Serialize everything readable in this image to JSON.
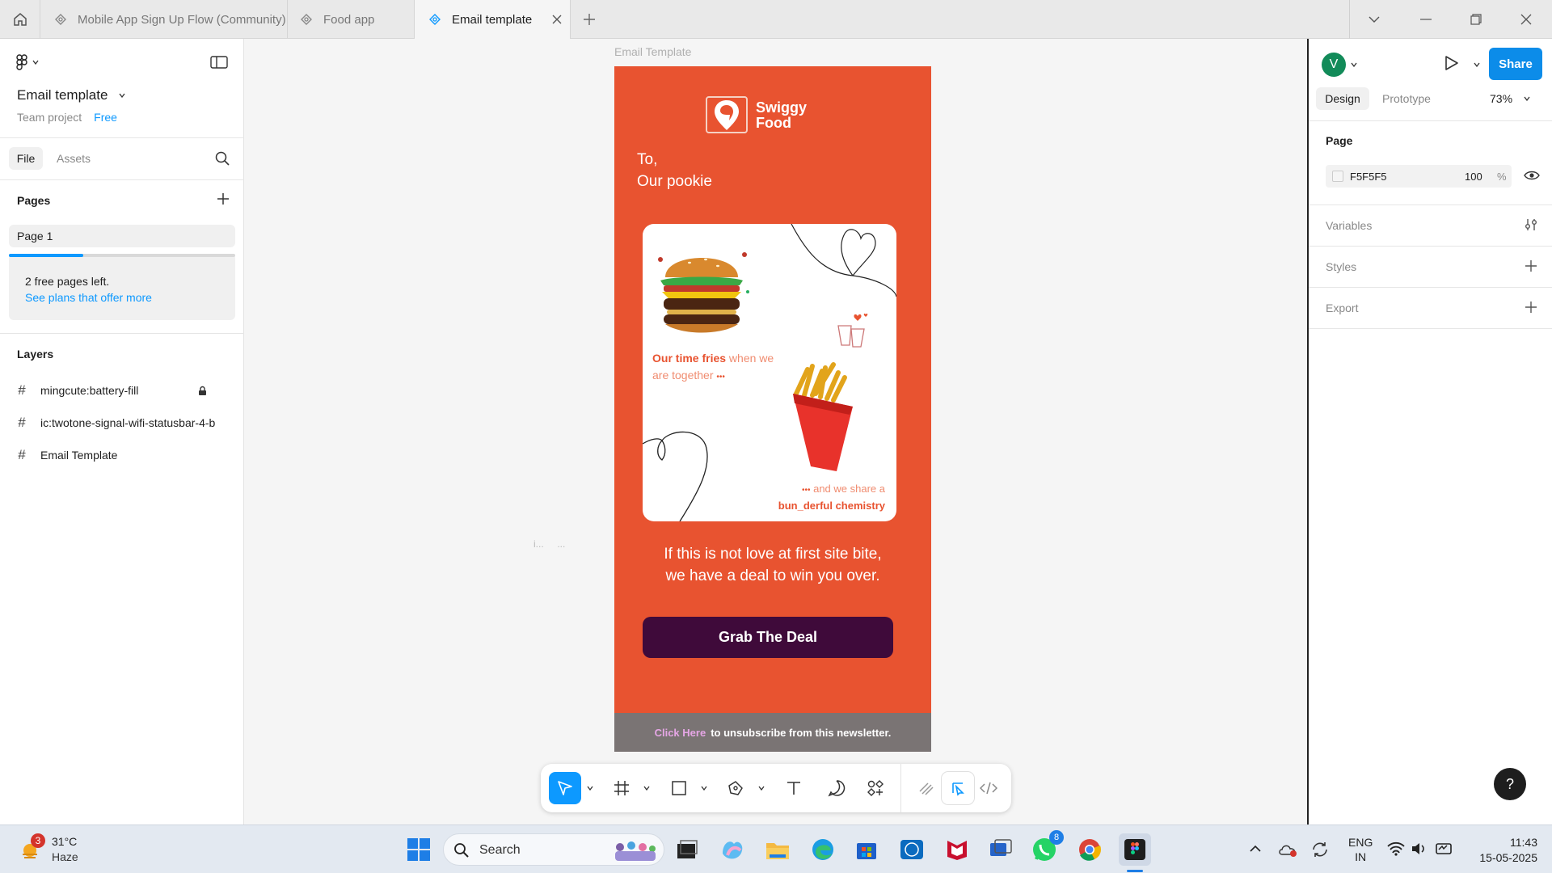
{
  "tabs": [
    {
      "label": "Mobile App Sign Up Flow (Community)"
    },
    {
      "label": "Food app"
    },
    {
      "label": "Email template"
    }
  ],
  "file": {
    "name": "Email template",
    "team": "Team project",
    "plan": "Free"
  },
  "left_tabs": {
    "file": "File",
    "assets": "Assets"
  },
  "pages": {
    "heading": "Pages",
    "items": [
      {
        "label": "Page 1"
      }
    ],
    "notice": "2 free pages left.",
    "link": "See plans that offer more",
    "usage_fraction": 0.33
  },
  "layers": {
    "heading": "Layers",
    "items": [
      {
        "label": "mingcute:battery-fill"
      },
      {
        "label": "ic:twotone-signal-wifi-statusbar-4-b"
      },
      {
        "label": "Email Template"
      }
    ]
  },
  "canvas": {
    "frame_label": "Email Template",
    "stray_text": "i...     ...",
    "email": {
      "brand_line1": "Swiggy",
      "brand_line2": "Food",
      "greeting_line1": "To,",
      "greeting_line2": "Our pookie",
      "tagline1_bold": "Our time fries",
      "tagline1_rest": " when we",
      "tagline1_line2": "are together",
      "dots": "•••",
      "tagline2_line1": "and we share a",
      "tagline2_bold": "bun_derful chemistry",
      "body_line1": "If this is not love at first site bite,",
      "body_line2": "we have a deal to win you over.",
      "cta": "Grab The Deal",
      "footer_link": "Click Here",
      "footer_text": "to unsubscribe from this newsletter."
    }
  },
  "right": {
    "avatar": "V",
    "share": "Share",
    "tab_design": "Design",
    "tab_prototype": "Prototype",
    "zoom": "73%",
    "page_heading": "Page",
    "page_color": "F5F5F5",
    "page_opacity": "100",
    "percent": "%",
    "variables": "Variables",
    "styles": "Styles",
    "export": "Export",
    "help": "?"
  },
  "taskbar": {
    "weather_temp": "31°C",
    "weather_desc": "Haze",
    "weather_badge": "3",
    "search": "Search",
    "whatsapp_badge": "8",
    "lang1": "ENG",
    "lang2": "IN",
    "time": "11:43",
    "date": "15-05-2025"
  },
  "colors": {
    "email_bg": "#E85330",
    "cta_bg": "#3F0A3A",
    "footer_bg": "#7A7474",
    "figma_blue": "#0D99FF",
    "share_blue": "#0C8CE9"
  }
}
